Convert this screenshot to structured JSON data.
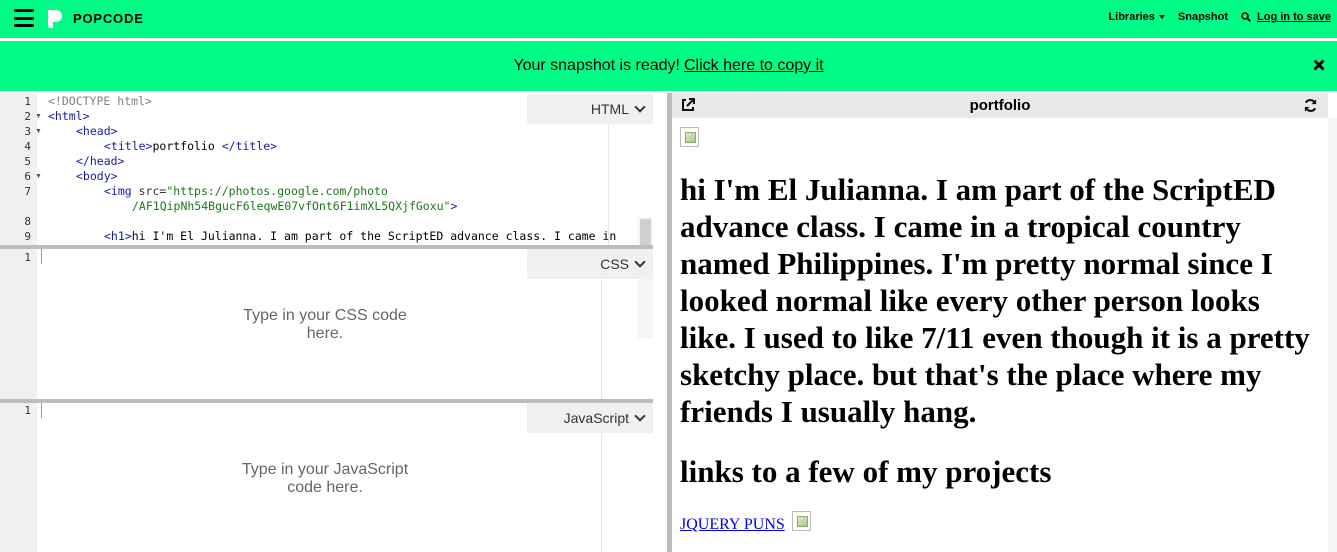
{
  "topbar": {
    "brand": "POPCODE",
    "libraries_label": "Libraries",
    "snapshot_label": "Snapshot",
    "login_label": "Log in to save"
  },
  "notification": {
    "message": "Your snapshot is ready!",
    "link_text": "Click here to copy it"
  },
  "html_editor": {
    "label": "HTML",
    "line_numbers": [
      "1",
      "2",
      "3",
      "4",
      "5",
      "6",
      "7",
      "8",
      "9"
    ],
    "lines": {
      "l1": "<!DOCTYPE html>",
      "l2_tag": "<html>",
      "l3_tag": "<head>",
      "l4_open": "<title>",
      "l4_text": "portfolio ",
      "l4_close": "</title>",
      "l5_tag": "</head>",
      "l6_tag": "<body>",
      "l7_open": "<img",
      "l7_attr": " src=",
      "l7_str1": "\"https://photos.google.com/photo",
      "l7_str2": "/AF1QipNh54BgucF6leqwE07vfOnt6F1imXL5QXjfGoxu\"",
      "l7_end": ">",
      "l9_open": "<h1>",
      "l9_text": "hi I'm El Julianna. I am part of the ScriptED advance class. I came in"
    }
  },
  "css_editor": {
    "label": "CSS",
    "line_number": "1",
    "placeholder_line1": "Type in your CSS code",
    "placeholder_line2": "here."
  },
  "js_editor": {
    "label": "JavaScript",
    "line_number": "1",
    "placeholder_line1": "Type in your JavaScript",
    "placeholder_line2": "code here."
  },
  "preview": {
    "title": "portfolio",
    "heading": "hi I'm El Julianna. I am part of the ScriptED advance class. I came in a tropical country named Philippines. I'm pretty normal since I looked normal like every other person looks like. I used to like 7/11 even though it is a pretty sketchy place. but that's the place where my friends I usually hang.",
    "subheading": "links to a few of my projects",
    "link_text": "JQUERY PUNS"
  }
}
